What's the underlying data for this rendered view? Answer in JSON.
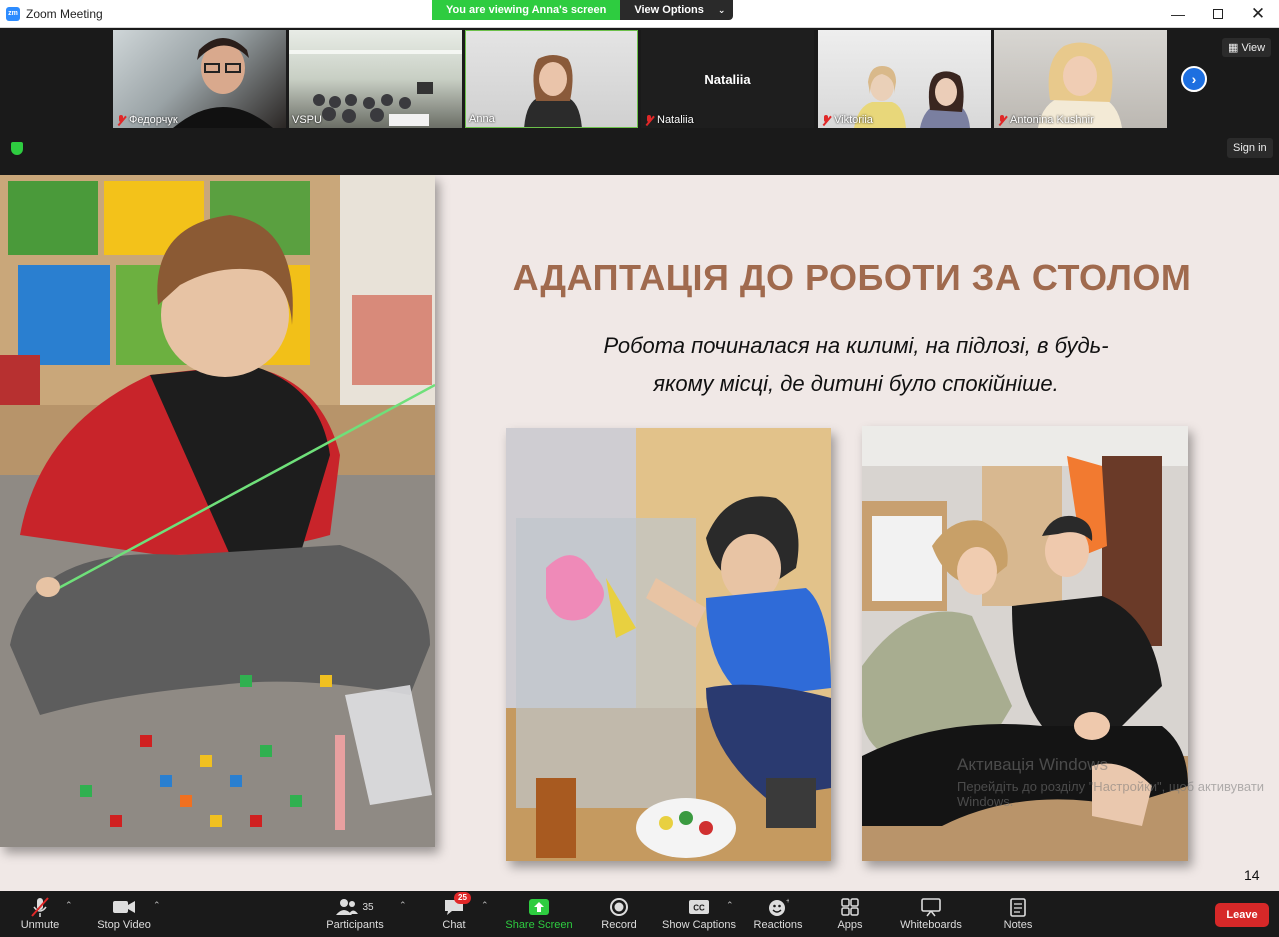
{
  "window": {
    "title": "Zoom Meeting"
  },
  "share_banner": {
    "status": "You are viewing Anna's screen",
    "view_options": "View Options"
  },
  "gallery": {
    "participants": [
      {
        "name": "Федорчук",
        "muted": true
      },
      {
        "name": "VSPU",
        "muted": false
      },
      {
        "name": "Anna",
        "muted": false
      },
      {
        "name": "Nataliia",
        "muted": true,
        "center_name": "Nataliia"
      },
      {
        "name": "Viktoriia",
        "muted": true
      },
      {
        "name": "Antonina Kushnir",
        "muted": true
      }
    ],
    "view_button": "View",
    "sign_in": "Sign in"
  },
  "slide": {
    "title": "АДАПТАЦІЯ ДО РОБОТИ ЗА СТОЛОМ",
    "subtitle_line1": "Робота починалася на килимі, на підлозі, в будь-",
    "subtitle_line2": "якому місці, де дитині було спокійніше.",
    "page_number": "14",
    "watermark_line1": "Активація Windows",
    "watermark_line2": "Перейдіть до розділу \"Настройки\", щоб активувати Windows."
  },
  "toolbar": {
    "unmute": "Unmute",
    "stop_video": "Stop Video",
    "participants": "Participants",
    "participants_count": "35",
    "chat": "Chat",
    "chat_badge": "25",
    "share_screen": "Share Screen",
    "record": "Record",
    "show_captions": "Show Captions",
    "reactions": "Reactions",
    "apps": "Apps",
    "whiteboards": "Whiteboards",
    "notes": "Notes",
    "leave": "Leave"
  },
  "colors": {
    "accent_green": "#2ecc40",
    "leave_red": "#d62828",
    "title_brown": "#a06a4e",
    "zoom_blue": "#2d8cff"
  }
}
